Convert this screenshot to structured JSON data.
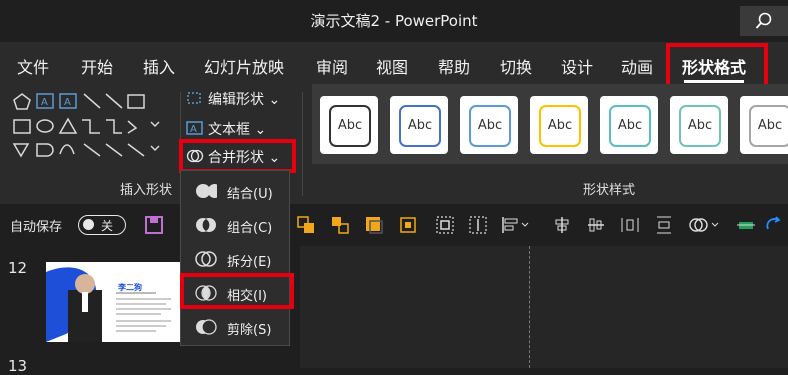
{
  "window": {
    "title": "演示文稿2 - PowerPoint"
  },
  "tabs": [
    "文件",
    "开始",
    "插入",
    "幻灯片放映",
    "审阅",
    "视图",
    "帮助",
    "切换",
    "设计",
    "动画",
    "形状格式"
  ],
  "active_tab": "形状格式",
  "ribbon": {
    "insert_shapes_group": "插入形状",
    "edit_shape": "编辑形状",
    "text_box": "文本框",
    "merge_shapes": "合并形状",
    "shape_styles_group": "形状样式",
    "style_sample_text": "Abc",
    "style_colors": [
      "#333333",
      "#4472c4",
      "#5b9bd5",
      "#ffc000",
      "#5bbcc7",
      "#70c4b4",
      "#a5a5a5"
    ]
  },
  "toolbar": {
    "autosave_label": "自动保存",
    "autosave_state": "关"
  },
  "merge_menu": {
    "items": [
      "结合(U)",
      "组合(C)",
      "拆分(E)",
      "相交(I)",
      "剪除(S)"
    ],
    "highlighted": "相交(I)"
  },
  "slides": {
    "current_number": "12",
    "thumb_name": "李二狗"
  },
  "accent": "#e6000f"
}
